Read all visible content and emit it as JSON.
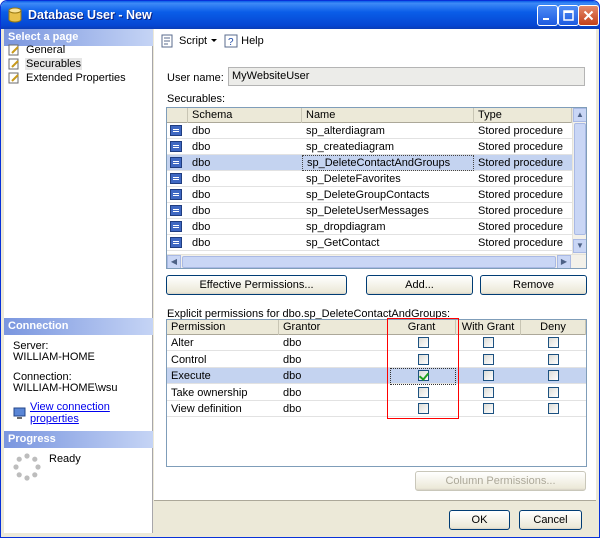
{
  "window": {
    "title": "Database User - New"
  },
  "left_pane": {
    "select_page_header": "Select a page",
    "pages": [
      {
        "label": "General",
        "icon": "page-icon",
        "selected": false
      },
      {
        "label": "Securables",
        "icon": "page-icon",
        "selected": true
      },
      {
        "label": "Extended Properties",
        "icon": "page-icon",
        "selected": false
      }
    ],
    "connection_header": "Connection",
    "server_label": "Server:",
    "server_value": "WILLIAM-HOME",
    "connection_label": "Connection:",
    "connection_value": "WILLIAM-HOME\\wsu",
    "view_connection_link": "View connection properties",
    "progress_header": "Progress",
    "progress_status": "Ready"
  },
  "toolbar": {
    "script_label": "Script",
    "help_label": "Help"
  },
  "form": {
    "user_name_label": "User name:",
    "user_name_value": "MyWebsiteUser",
    "securables_label": "Securables:"
  },
  "securables": {
    "columns": [
      "Schema",
      "Name",
      "Type"
    ],
    "rows": [
      {
        "schema": "dbo",
        "name": "sp_alterdiagram",
        "type": "Stored procedure",
        "selected": false
      },
      {
        "schema": "dbo",
        "name": "sp_creatediagram",
        "type": "Stored procedure",
        "selected": false
      },
      {
        "schema": "dbo",
        "name": "sp_DeleteContactAndGroups",
        "type": "Stored procedure",
        "selected": true
      },
      {
        "schema": "dbo",
        "name": "sp_DeleteFavorites",
        "type": "Stored procedure",
        "selected": false
      },
      {
        "schema": "dbo",
        "name": "sp_DeleteGroupContacts",
        "type": "Stored procedure",
        "selected": false
      },
      {
        "schema": "dbo",
        "name": "sp_DeleteUserMessages",
        "type": "Stored procedure",
        "selected": false
      },
      {
        "schema": "dbo",
        "name": "sp_dropdiagram",
        "type": "Stored procedure",
        "selected": false
      },
      {
        "schema": "dbo",
        "name": "sp_GetContact",
        "type": "Stored procedure",
        "selected": false
      }
    ]
  },
  "buttons": {
    "effective_permissions": "Effective Permissions...",
    "add": "Add...",
    "remove": "Remove",
    "column_permissions": "Column Permissions...",
    "ok": "OK",
    "cancel": "Cancel"
  },
  "permissions": {
    "label": "Explicit permissions for dbo.sp_DeleteContactAndGroups:",
    "columns": [
      "Permission",
      "Grantor",
      "Grant",
      "With Grant",
      "Deny"
    ],
    "rows": [
      {
        "permission": "Alter",
        "grantor": "dbo",
        "grant": false,
        "with_grant": false,
        "deny": false,
        "selected": false
      },
      {
        "permission": "Control",
        "grantor": "dbo",
        "grant": false,
        "with_grant": false,
        "deny": false,
        "selected": false
      },
      {
        "permission": "Execute",
        "grantor": "dbo",
        "grant": true,
        "with_grant": false,
        "deny": false,
        "selected": true
      },
      {
        "permission": "Take ownership",
        "grantor": "dbo",
        "grant": false,
        "with_grant": false,
        "deny": false,
        "selected": false
      },
      {
        "permission": "View definition",
        "grantor": "dbo",
        "grant": false,
        "with_grant": false,
        "deny": false,
        "selected": false
      }
    ]
  }
}
